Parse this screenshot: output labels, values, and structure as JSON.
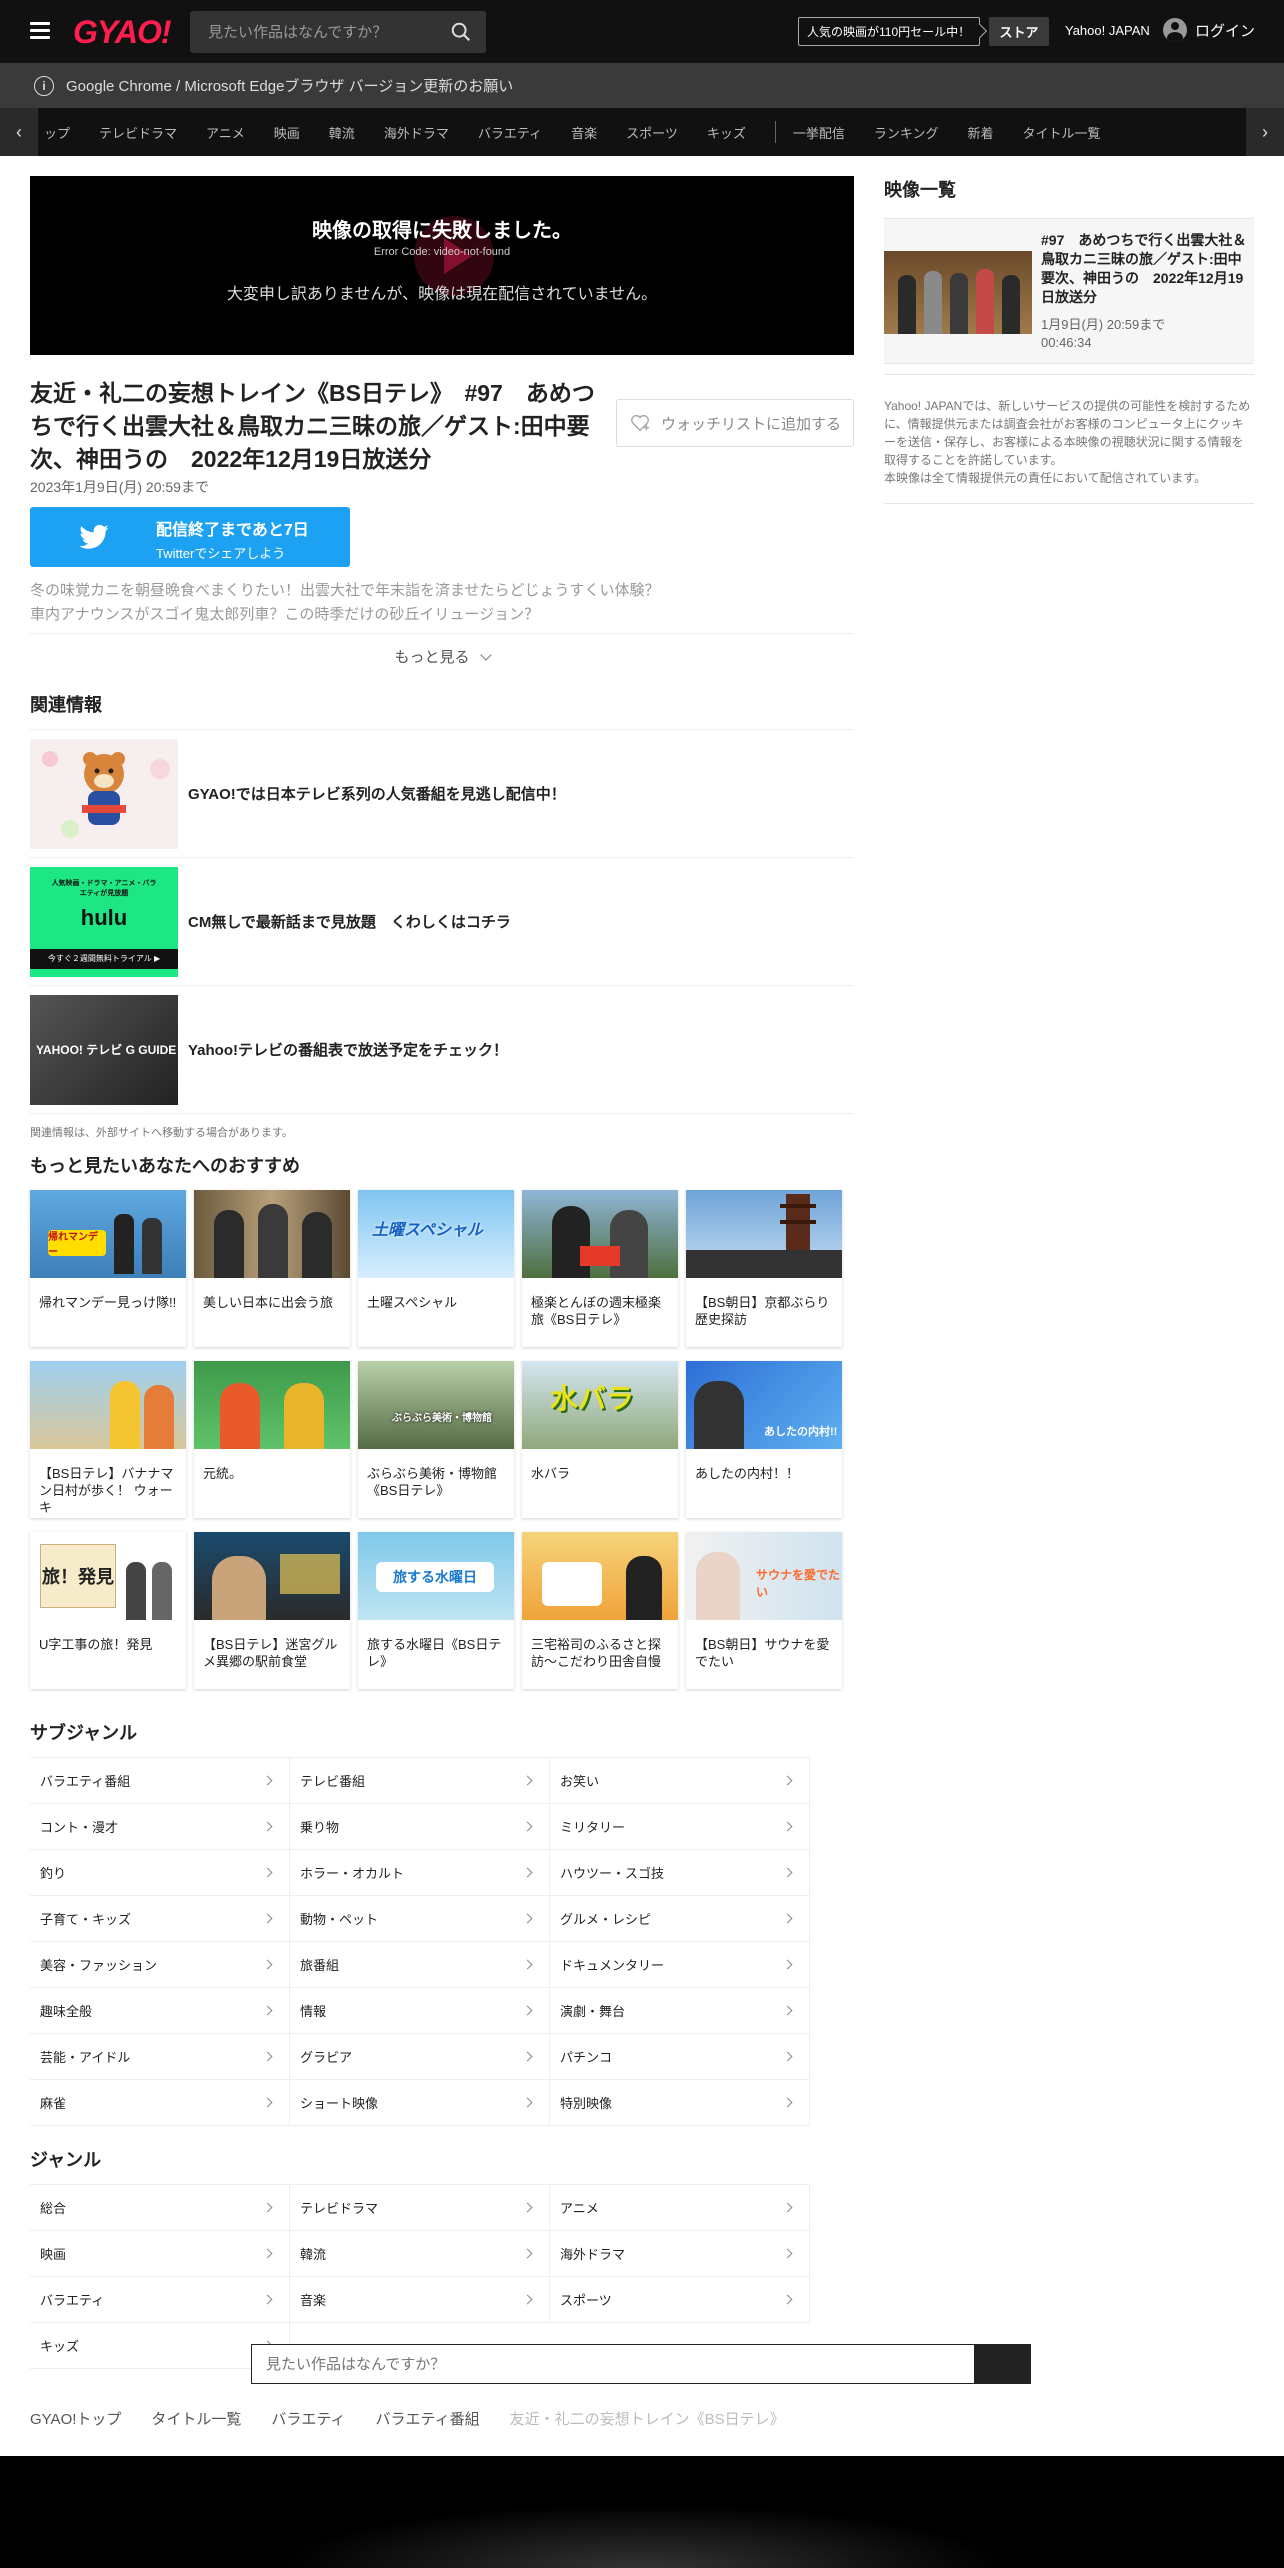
{
  "header": {
    "logo": "GYAO!",
    "search_placeholder": "見たい作品はなんですか？",
    "promo": "人気の映画が110円セール中！",
    "store": "ストア",
    "yahoo": "Yahoo! JAPAN",
    "login": "ログイン"
  },
  "notice": {
    "text": "Google Chrome / Microsoft Edgeブラウザ バージョン更新のお願い"
  },
  "nav": {
    "items": [
      "ップ",
      "テレビドラマ",
      "アニメ",
      "映画",
      "韓流",
      "海外ドラマ",
      "バラエティ",
      "音楽",
      "スポーツ",
      "キッズ"
    ],
    "items2": [
      "一挙配信",
      "ランキング",
      "新着",
      "タイトル一覧"
    ]
  },
  "player": {
    "error_title": "映像の取得に失敗しました。",
    "error_code": "Error Code: video-not-found",
    "error_msg": "大変申し訳ありませんが、映像は現在配信されていません。"
  },
  "program": {
    "title": "友近・礼二の妄想トレイン《BS日テレ》　#97　あめつちで行く出雲大社＆鳥取カニ三昧の旅／ゲスト:田中要次、神田うの　2022年12月19日放送分",
    "watchlist": "ウォッチリストに追加する",
    "date": "2023年1月9日(月) 20:59まで",
    "twitter_line1": "配信終了まであと7日",
    "twitter_line2": "Twitterでシェアしよう",
    "desc1": "冬の味覚カニを朝昼晩食べまくりたい！出雲大社で年末詣を済ませたらどじょうすくい体験？",
    "desc2": "車内アナウンスがスゴイ鬼太郎列車？この時季だけの砂丘イリュージョン？",
    "more": "もっと見る"
  },
  "related": {
    "heading": "関連情報",
    "items": [
      {
        "text": "GYAO!では日本テレビ系列の人気番組を見逃し配信中！"
      },
      {
        "text": "CM無しで最新話まで見放題　くわしくはコチラ",
        "thumb_text": "hulu",
        "thumb_top": "人気映画・ドラマ・アニメ・バラエティが見放題",
        "thumb_bottom": "今すぐ２週間無料トライアル ▶"
      },
      {
        "text": "Yahoo!テレビの番組表で放送予定をチェック！",
        "thumb_text": "YAHOO! テレビ G GUIDE"
      }
    ],
    "note": "関連情報は、外部サイトへ移動する場合があります。"
  },
  "recommend": {
    "heading": "もっと見たいあなたへのおすすめ",
    "cards": [
      {
        "title": "帰れマンデー見っけ隊!!",
        "thumb_text": "帰れマンデー"
      },
      {
        "title": "美しい日本に出会う旅"
      },
      {
        "title": "土曜スペシャル",
        "thumb_text": "土曜スペシャル"
      },
      {
        "title": "極楽とんぼの週末極楽旅《BS日テレ》"
      },
      {
        "title": "【BS朝日】京都ぶらり歴史探訪"
      },
      {
        "title": "【BS日テレ】バナナマン日村が歩く！ ウォーキ"
      },
      {
        "title": "元統。"
      },
      {
        "title": "ぶらぶら美術・博物館《BS日テレ》",
        "thumb_text": "ぶらぶら美術・博物館"
      },
      {
        "title": "水バラ",
        "thumb_text": "水バラ"
      },
      {
        "title": "あしたの内村！！",
        "thumb_text": "あしたの内村!!"
      },
      {
        "title": "U字工事の旅！発見",
        "thumb_text": "旅！発見"
      },
      {
        "title": "【BS日テレ】迷宮グルメ異郷の駅前食堂"
      },
      {
        "title": "旅する水曜日《BS日テレ》",
        "thumb_text": "旅する水曜日"
      },
      {
        "title": "三宅裕司のふるさと探訪～こだわり田舎自慢"
      },
      {
        "title": "【BS朝日】サウナを愛でたい",
        "thumb_text": "サウナを愛でたい"
      }
    ]
  },
  "subgenre": {
    "heading": "サブジャンル",
    "items": [
      "バラエティ番組",
      "テレビ番組",
      "お笑い",
      "コント・漫才",
      "乗り物",
      "ミリタリー",
      "釣り",
      "ホラー・オカルト",
      "ハウツー・スゴ技",
      "子育て・キッズ",
      "動物・ペット",
      "グルメ・レシピ",
      "美容・ファッション",
      "旅番組",
      "ドキュメンタリー",
      "趣味全般",
      "情報",
      "演劇・舞台",
      "芸能・アイドル",
      "グラビア",
      "パチンコ",
      "麻雀",
      "ショート映像",
      "特別映像"
    ]
  },
  "genre": {
    "heading": "ジャンル",
    "items": [
      "総合",
      "テレビドラマ",
      "アニメ",
      "映画",
      "韓流",
      "海外ドラマ",
      "バラエティ",
      "音楽",
      "スポーツ",
      "キッズ"
    ]
  },
  "bottom_search": {
    "placeholder": "見たい作品はなんですか？"
  },
  "breadcrumb": [
    "GYAO!トップ",
    "タイトル一覧",
    "バラエティ",
    "バラエティ番組",
    "友近・礼二の妄想トレイン《BS日テレ》"
  ],
  "side": {
    "heading": "映像一覧",
    "card_title": "#97　あめつちで行く出雲大社＆鳥取カニ三昧の旅／ゲスト:田中要次、神田うの　2022年12月19日放送分",
    "card_date": "1月9日(月) 20:59まで",
    "card_duration": "00:46:34",
    "notice": "Yahoo! JAPANでは、新しいサービスの提供の可能性を検討するために、情報提供元または調査会社がお客様のコンピュータ上にクッキーを送信・保存し、お客様による本映像の視聴状況に関する情報を取得することを許諾しています。",
    "notice2": "本映像は全て情報提供元の責任において配信されています。"
  },
  "colors": {
    "brand": "#ff1e4e",
    "twitter": "#1da1f2",
    "header_bg": "#111111"
  }
}
